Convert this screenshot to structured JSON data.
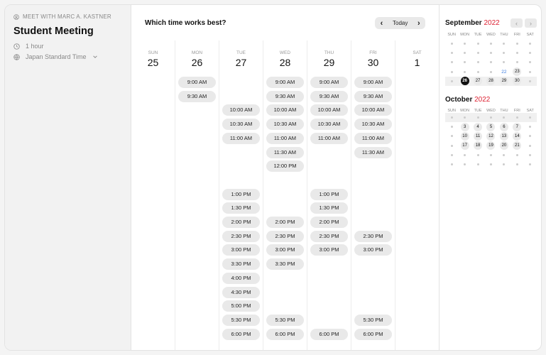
{
  "sidebar": {
    "meet_label": "MEET WITH MARC A. KASTNER",
    "title": "Student Meeting",
    "duration": "1 hour",
    "timezone": "Japan Standard Time"
  },
  "header": {
    "question": "Which time works best?",
    "today_label": "Today"
  },
  "days": [
    {
      "name": "SUN",
      "num": "25",
      "slots": []
    },
    {
      "name": "MON",
      "num": "26",
      "slots": [
        "9:00 AM",
        "9:30 AM"
      ]
    },
    {
      "name": "TUE",
      "num": "27",
      "slots": [
        "10:00 AM",
        "10:30 AM",
        "11:00 AM",
        "1:00 PM",
        "1:30 PM",
        "2:00 PM",
        "2:30 PM",
        "3:00 PM",
        "3:30 PM",
        "4:00 PM",
        "4:30 PM",
        "5:00 PM",
        "5:30 PM",
        "6:00 PM"
      ]
    },
    {
      "name": "WED",
      "num": "28",
      "slots": [
        "9:00 AM",
        "9:30 AM",
        "10:00 AM",
        "10:30 AM",
        "11:00 AM",
        "11:30 AM",
        "12:00 PM",
        "2:00 PM",
        "2:30 PM",
        "3:00 PM",
        "3:30 PM",
        "5:30 PM",
        "6:00 PM"
      ]
    },
    {
      "name": "THU",
      "num": "29",
      "slots": [
        "9:00 AM",
        "9:30 AM",
        "10:00 AM",
        "10:30 AM",
        "11:00 AM",
        "1:00 PM",
        "1:30 PM",
        "2:00 PM",
        "2:30 PM",
        "3:00 PM",
        "6:00 PM"
      ]
    },
    {
      "name": "FRI",
      "num": "30",
      "slots": [
        "9:00 AM",
        "9:30 AM",
        "10:00 AM",
        "10:30 AM",
        "11:00 AM",
        "11:30 AM",
        "2:30 PM",
        "3:00 PM",
        "5:30 PM",
        "6:00 PM"
      ]
    },
    {
      "name": "SAT",
      "num": "1",
      "slots": []
    }
  ],
  "mini_calendar": {
    "weekdays": [
      "SUN",
      "MON",
      "TUE",
      "WED",
      "THU",
      "FRI",
      "SAT"
    ],
    "months": [
      {
        "name": "September",
        "year": "2022",
        "rows": [
          [
            "",
            "",
            "",
            "",
            "",
            "",
            ""
          ],
          [
            "",
            "",
            "",
            "",
            "",
            "",
            ""
          ],
          [
            "",
            "",
            "",
            "",
            "",
            "",
            ""
          ],
          [
            "",
            "",
            "",
            "",
            "22",
            "23",
            ""
          ],
          [
            "",
            "26",
            "27",
            "28",
            "29",
            "30",
            ""
          ]
        ],
        "selected": "26",
        "highlight": "22",
        "available": [
          "23",
          "26",
          "27",
          "28",
          "29",
          "30"
        ]
      },
      {
        "name": "October",
        "year": "2022",
        "rows": [
          [
            "",
            "",
            "",
            "",
            "",
            "",
            ""
          ],
          [
            "",
            "3",
            "4",
            "5",
            "6",
            "7",
            ""
          ],
          [
            "",
            "10",
            "11",
            "12",
            "13",
            "14",
            ""
          ],
          [
            "",
            "17",
            "18",
            "19",
            "20",
            "21",
            ""
          ],
          [
            "",
            "",
            "",
            "",
            "",
            "",
            ""
          ],
          [
            "",
            "",
            "",
            "",
            "",
            "",
            ""
          ]
        ],
        "available": [
          "3",
          "4",
          "5",
          "6",
          "7",
          "10",
          "11",
          "12",
          "13",
          "14",
          "17",
          "18",
          "19",
          "20",
          "21"
        ]
      }
    ]
  },
  "colors": {
    "accent": "#dd2233",
    "selected": "#111111",
    "link": "#3a7be0"
  }
}
